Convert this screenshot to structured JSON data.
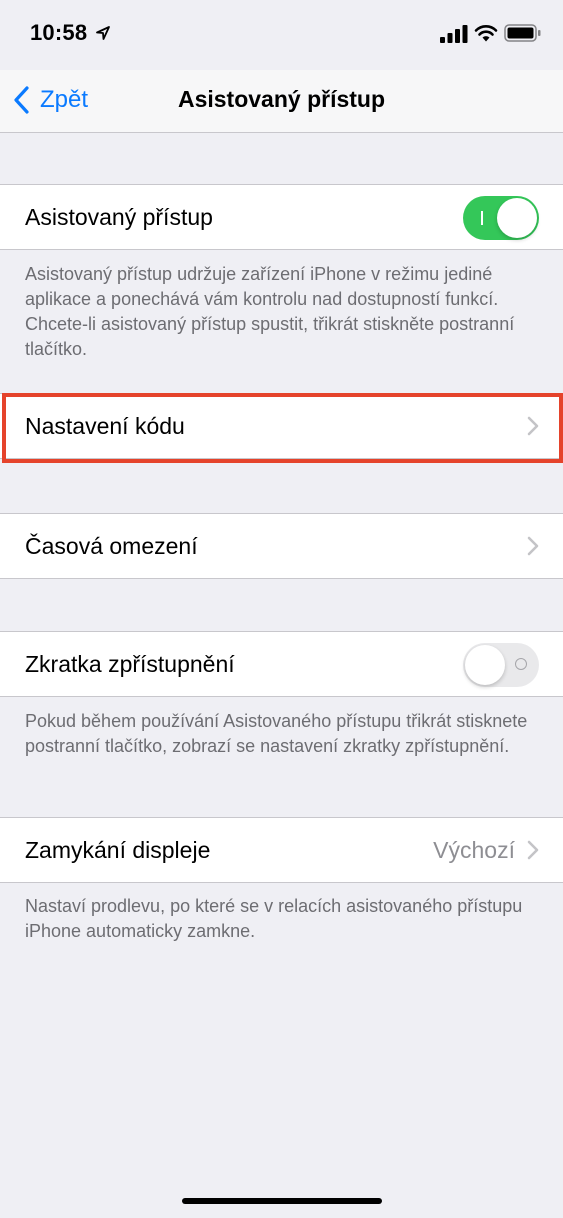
{
  "status_bar": {
    "time": "10:58"
  },
  "nav": {
    "back_label": "Zpět",
    "title": "Asistovaný přístup"
  },
  "guided_access": {
    "label": "Asistovaný přístup",
    "toggle_on": true,
    "footer": "Asistovaný přístup udržuje zařízení iPhone v režimu jediné aplikace a ponechává vám kontrolu nad dostupností funkcí. Chcete-li asistovaný přístup spustit, třikrát stiskněte postranní tlačítko."
  },
  "passcode_settings": {
    "label": "Nastavení kódu"
  },
  "time_limits": {
    "label": "Časová omezení"
  },
  "accessibility_shortcut": {
    "label": "Zkratka zpřístupnění",
    "toggle_on": false,
    "footer": "Pokud během používání Asistovaného přístupu třikrát stisknete postranní tlačítko, zobrazí se nastavení zkratky zpřístupnění."
  },
  "display_auto_lock": {
    "label": "Zamykání displeje",
    "value": "Výchozí",
    "footer": "Nastaví prodlevu, po které se v relacích asistovaného přístupu iPhone automaticky zamkne."
  },
  "colors": {
    "accent": "#0a7aff",
    "toggle_on": "#34c759",
    "highlight": "#e5432b"
  }
}
